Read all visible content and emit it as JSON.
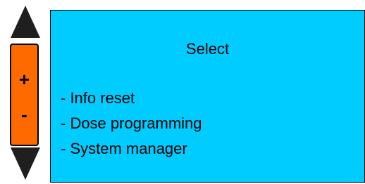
{
  "controls": {
    "up_icon": "triangle-up",
    "down_icon": "triangle-down",
    "plus_label": "+",
    "minus_label": "-"
  },
  "screen": {
    "title": "Select",
    "items": [
      {
        "label": "- Info reset"
      },
      {
        "label": "- Dose programming"
      },
      {
        "label": "- System manager"
      }
    ]
  },
  "colors": {
    "stepper_fill": "#ff6a00",
    "screen_fill": "#00ccff",
    "arrow_fill": "#1f1f1f",
    "border": "#000000"
  }
}
